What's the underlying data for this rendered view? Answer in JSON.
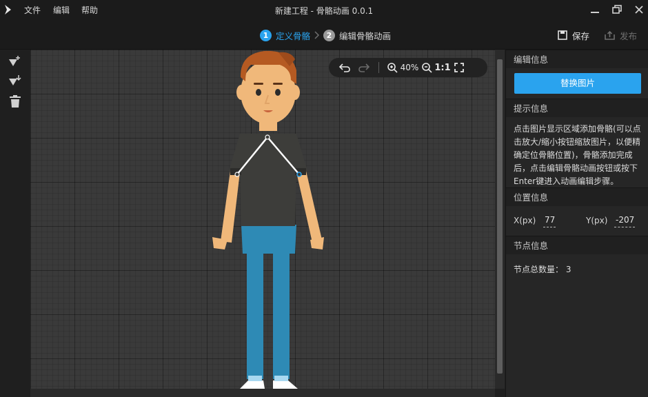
{
  "app": {
    "title": "新建工程 - 骨骼动画 0.0.1",
    "menu": [
      "文件",
      "编辑",
      "帮助"
    ]
  },
  "steps": [
    {
      "num": "1",
      "label": "定义骨骼",
      "active": true
    },
    {
      "num": "2",
      "label": "编辑骨骼动画",
      "active": false
    }
  ],
  "actions": {
    "save": "保存",
    "publish": "发布"
  },
  "zoom": {
    "level": "40%",
    "reset": "1:1"
  },
  "panel": {
    "edit_info": "编辑信息",
    "replace_button": "替换图片",
    "hint_header": "提示信息",
    "hint_text": "点击图片显示区域添加骨骼(可以点击放大/缩小按钮缩放图片，以便精确定位骨骼位置)，骨骼添加完成后，点击编辑骨骼动画按钮或按下Enter键进入动画编辑步骤。",
    "position_header": "位置信息",
    "x_label": "X(px)",
    "x_value": "77",
    "y_label": "Y(px)",
    "y_value": "-207",
    "node_header": "节点信息",
    "node_count_label": "节点总数量：",
    "node_count": "3"
  },
  "colors": {
    "accent": "#2aa3ee",
    "background": "#1b1b1b",
    "canvas": "#3a3a3a"
  },
  "icons": [
    "app-logo-icon",
    "minimize-icon",
    "restore-icon",
    "close-icon",
    "save-icon",
    "publish-icon",
    "add-bone-icon",
    "import-bone-icon",
    "delete-icon",
    "undo-icon",
    "redo-icon",
    "zoom-in-icon",
    "zoom-out-icon",
    "fullscreen-icon"
  ]
}
